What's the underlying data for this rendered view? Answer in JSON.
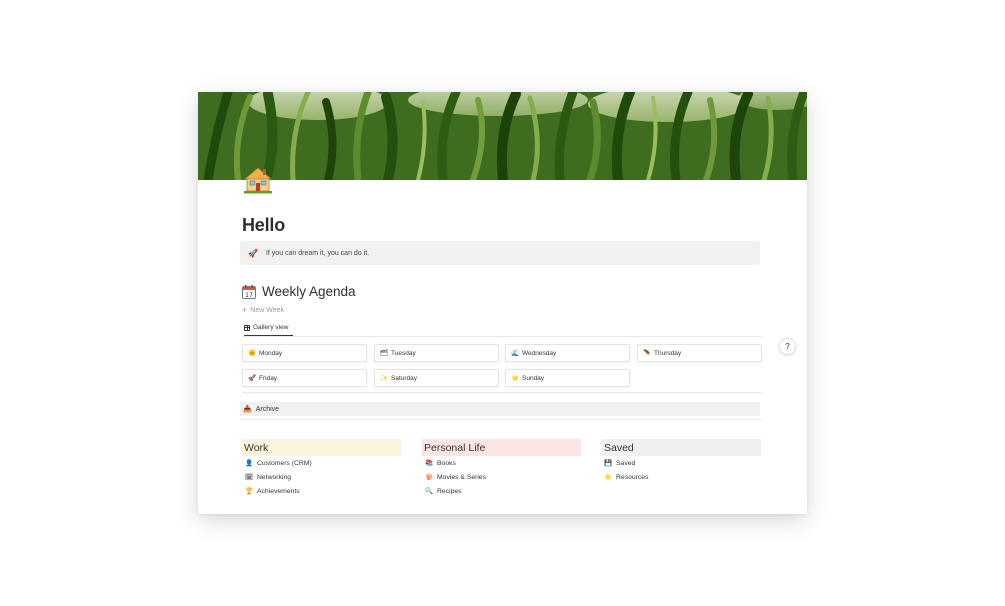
{
  "page": {
    "title": "Hello",
    "icon": "house-icon",
    "cover": "grass-cover-image"
  },
  "callout": {
    "icon": "🚀",
    "text": "If you can dream it, you can do it."
  },
  "agenda": {
    "icon": "calendar-icon",
    "heading": "Weekly Agenda",
    "new_label": "New Week",
    "view_label": "Gallery view",
    "cards": [
      {
        "icon": "🌞",
        "label": "Monday"
      },
      {
        "icon": "🗂",
        "label": "Tuesday"
      },
      {
        "icon": "🌊",
        "label": "Wednesday"
      },
      {
        "icon": "🪶",
        "label": "Thursday"
      },
      {
        "icon": "🚀",
        "label": "Friday"
      },
      {
        "icon": "✨",
        "label": "Saturday"
      },
      {
        "icon": "⭐",
        "label": "Sunday"
      }
    ]
  },
  "archive": {
    "icon": "📥",
    "label": "Archive"
  },
  "sections": {
    "work": {
      "heading": "Work",
      "color": "#fbf3db",
      "links": [
        {
          "icon": "👤",
          "label": "Customers (CRM)"
        },
        {
          "icon": "🗓",
          "label": "Networking"
        },
        {
          "icon": "🏆",
          "label": "Achievements"
        }
      ]
    },
    "personal": {
      "heading": "Personal Life",
      "color": "#fbe4e4",
      "links": [
        {
          "icon": "📚",
          "label": "Books"
        },
        {
          "icon": "🍿",
          "label": "Movies & Series"
        },
        {
          "icon": "🔍",
          "label": "Recipes"
        }
      ]
    },
    "saved": {
      "heading": "Saved",
      "color": "#edf3ec",
      "links": [
        {
          "icon": "💾",
          "label": "Saved"
        },
        {
          "icon": "⭐",
          "label": "Resources"
        }
      ]
    }
  },
  "help": {
    "label": "?"
  }
}
